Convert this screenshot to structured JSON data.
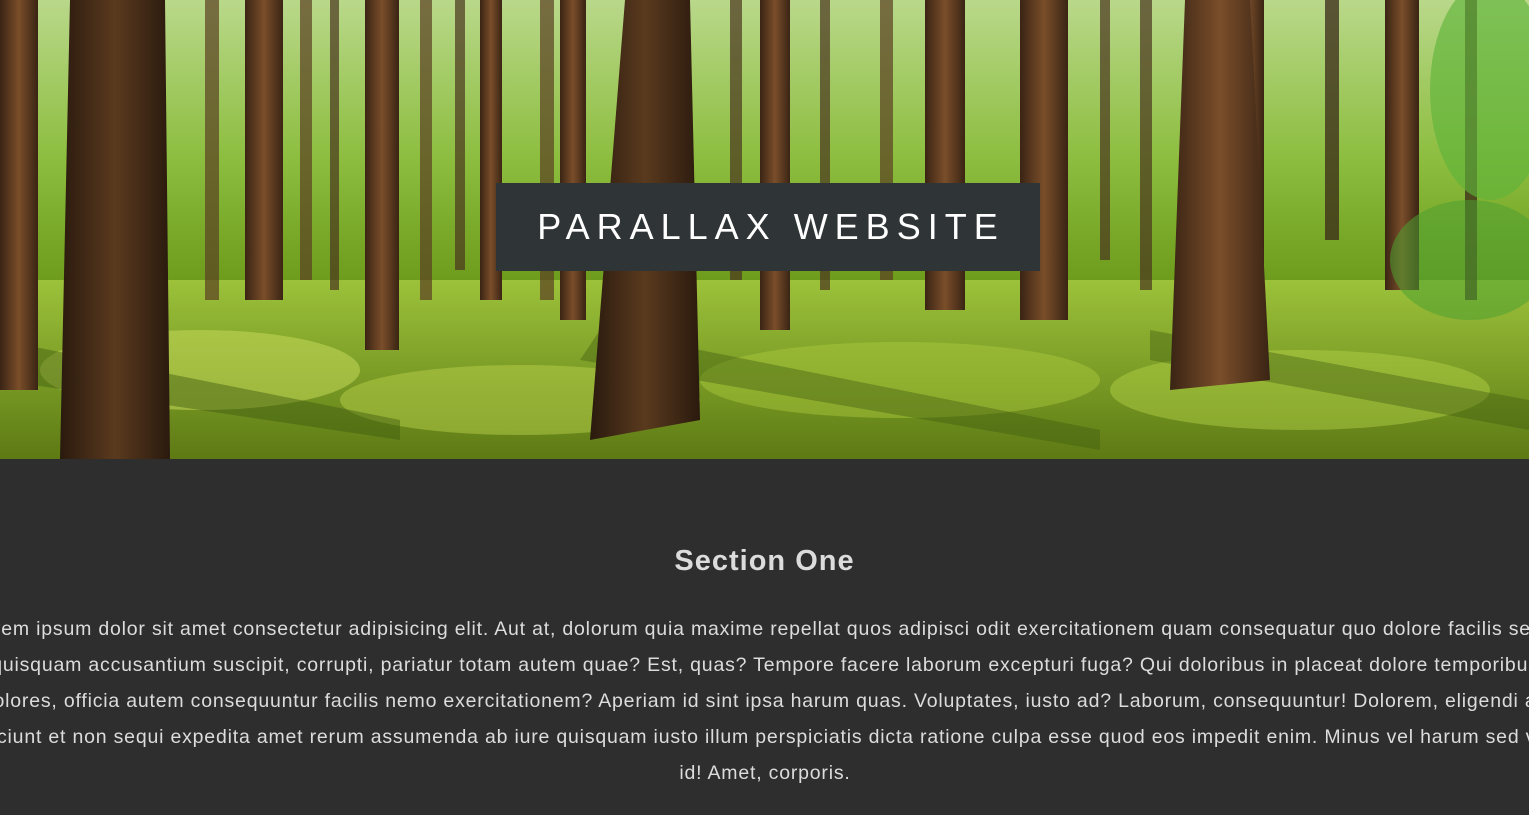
{
  "hero": {
    "title": "PARALLAX WEBSITE",
    "image_description_icon": "forest-background"
  },
  "section_one": {
    "title": "Section One",
    "body": "Lorem ipsum dolor sit amet consectetur adipisicing elit. Aut at, dolorum quia maxime repellat quos adipisci odit exercitationem quam consequatur quo dolore facilis sequi quisquam accusantium suscipit, corrupti, pariatur totam autem quae? Est, quas? Tempore facere laborum excepturi fuga? Qui doloribus in placeat dolore temporibus dolores, officia autem consequuntur facilis nemo exercitationem? Aperiam id sint ipsa harum quas. Voluptates, iusto ad? Laborum, consequuntur! Dolorem, eligendi ad nesciunt et non sequi expedita amet rerum assumenda ab iure quisquam iusto illum perspiciatis dicta ratione culpa esse quod eos impedit enim. Minus vel harum sed vero id! Amet, corporis."
  },
  "colors": {
    "title_box": "#2f3436",
    "section_background": "#2e2e2e",
    "section_text": "#dcdcdc"
  }
}
